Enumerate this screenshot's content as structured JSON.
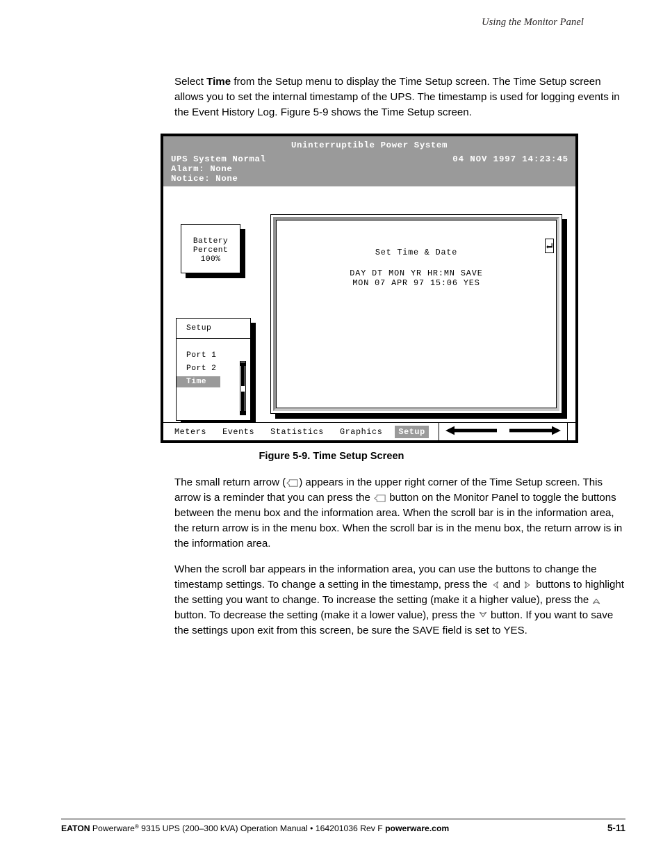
{
  "page": {
    "running_head": "Using the Monitor Panel",
    "page_number": "5-11"
  },
  "paragraphs": {
    "intro_a": "Select ",
    "intro_bold": "Time",
    "intro_b": " from the Setup menu to display the Time Setup screen. The Time Setup screen allows you to set the internal timestamp of the UPS. The timestamp is used for logging events in the Event History Log. Figure 5-9 shows the Time Setup screen.",
    "arrow_a": "The small return arrow (",
    "arrow_b": ") appears in the upper right corner of the Time Setup screen. This arrow is a reminder that you can press the ",
    "arrow_c": " button on the Monitor Panel to toggle the buttons between the menu box and the information area. When the scroll bar is in the information area, the return arrow is in the menu box. When the scroll bar is in the menu box, the return arrow is in the information area.",
    "scroll_a": "When the scroll bar appears in the information area, you can use the buttons to change the timestamp settings. To change a setting in the timestamp, press the ",
    "scroll_b": " and ",
    "scroll_c": " buttons to highlight the setting you want to change. To increase the setting (make it a higher value), press the ",
    "scroll_d": " button. To decrease the setting (make it a lower value), press the ",
    "scroll_e": " button. If you want to save the settings upon exit from this screen, be sure the SAVE field is set to YES."
  },
  "figure": {
    "caption": "Figure 5-9. Time Setup Screen",
    "screen": {
      "title": "Uninterruptible Power System",
      "status_normal": "UPS System Normal",
      "status_alarm": "Alarm:  None",
      "status_notice": "Notice: None",
      "date": "04 NOV 1997",
      "time": "14:23:45",
      "date_time": "04 NOV 1997  14:23:45",
      "battery": {
        "line1": "Battery",
        "line2": "Percent",
        "line3": "100%"
      },
      "menu": {
        "title": "Setup",
        "items": [
          {
            "label": "Port 1",
            "selected": false
          },
          {
            "label": "Port 2",
            "selected": false
          },
          {
            "label": "Time",
            "selected": true
          }
        ]
      },
      "info": {
        "title": "Set Time & Date",
        "headers": "DAY DT MON  YR HR:MN SAVE",
        "values": "MON 07 APR  97 15:06  YES",
        "fields": {
          "day": "MON",
          "dt": "07",
          "mon": "APR",
          "yr": "97",
          "hrmn": "15:06",
          "save": "YES"
        },
        "return_key_icon": "return-arrow-icon"
      },
      "tabs": [
        {
          "label": "Meters",
          "selected": false
        },
        {
          "label": "Events",
          "selected": false
        },
        {
          "label": "Statistics",
          "selected": false
        },
        {
          "label": "Graphics",
          "selected": false
        },
        {
          "label": "Setup",
          "selected": true
        }
      ],
      "nav": {
        "left_icon": "arrow-left-icon",
        "right_icon": "arrow-right-icon"
      }
    }
  },
  "footer": {
    "brand": "EATON",
    "product_a": " Powerware",
    "registered": "®",
    "product_b": " 9315 UPS (200–300 kVA) Operation Manual  •  164201036 Rev F  ",
    "site": "powerware.com"
  },
  "colors": {
    "header_band": "#9a9a9a",
    "highlight": "#9a9a9a",
    "screen_border": "#000000",
    "text": "#000000",
    "bevel_dark": "#8f8f8f",
    "bevel_light": "#c8c8c8"
  }
}
